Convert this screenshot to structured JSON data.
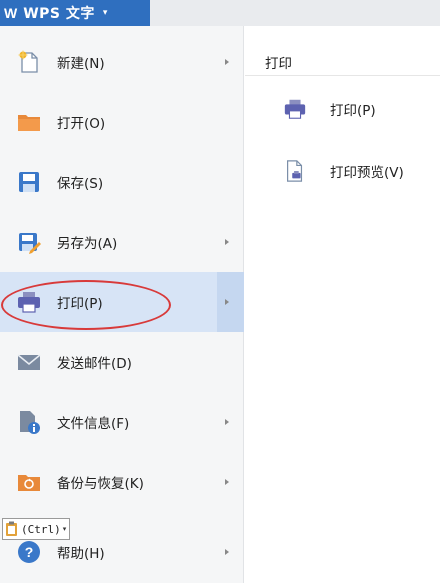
{
  "app": {
    "logo": "W",
    "title": "WPS 文字",
    "dropdown_glyph": "▾"
  },
  "menu": {
    "items": [
      {
        "label": "新建(N)",
        "icon": "new-document-icon",
        "has_submenu": true
      },
      {
        "label": "打开(O)",
        "icon": "folder-open-icon",
        "has_submenu": false
      },
      {
        "label": "保存(S)",
        "icon": "save-icon",
        "has_submenu": false
      },
      {
        "label": "另存为(A)",
        "icon": "save-as-icon",
        "has_submenu": true
      },
      {
        "label": "打印(P)",
        "icon": "printer-icon",
        "has_submenu": true,
        "selected": true
      },
      {
        "label": "发送邮件(D)",
        "icon": "mail-icon",
        "has_submenu": false
      },
      {
        "label": "文件信息(F)",
        "icon": "file-info-icon",
        "has_submenu": true
      },
      {
        "label": "备份与恢复(K)",
        "icon": "backup-icon",
        "has_submenu": true
      },
      {
        "label": "帮助(H)",
        "icon": "help-icon",
        "has_submenu": true
      }
    ]
  },
  "submenu": {
    "header": "打印",
    "items": [
      {
        "label": "打印(P)",
        "icon": "printer-icon"
      },
      {
        "label": "打印预览(V)",
        "icon": "print-preview-icon"
      }
    ]
  },
  "paste_badge": {
    "label": "(Ctrl)",
    "dropdown_glyph": "▾"
  },
  "colors": {
    "app_button": "#2f6fbf",
    "menu_bg": "#f5f6f7",
    "selected_bg": "#d7e4f6",
    "annotation_red": "#d83a3a"
  }
}
